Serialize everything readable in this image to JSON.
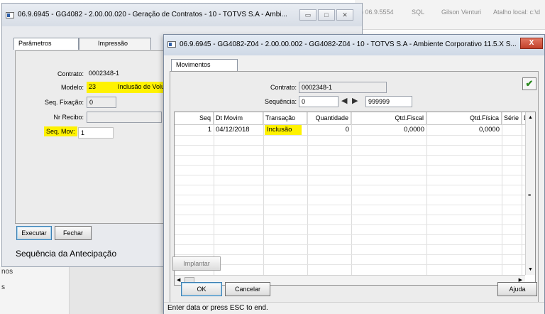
{
  "background": {
    "topbar": [
      "0) 06.9.5554",
      "SQL",
      "Gilson Venturi",
      "Atalho local: c:\\d"
    ],
    "side_items": [
      "nos",
      "s"
    ]
  },
  "win1": {
    "title": "06.9.6945 - GG4082 - 2.00.00.020 - Geração de Contratos - 10 - TOTVS S.A - Ambi...",
    "tabs": [
      "Parâmetros",
      "Impressão"
    ],
    "fields": {
      "contrato_label": "Contrato:",
      "contrato_value": "0002348-1",
      "modelo_label": "Modelo:",
      "modelo_value": "23",
      "modelo_desc": "Inclusão de Volu",
      "seq_fixacao_label": "Seq. Fixação:",
      "seq_fixacao_value": "0",
      "nr_recibo_label": "Nr Recibo:",
      "nr_recibo_value": "",
      "seq_mov_label": "Seq. Mov:",
      "seq_mov_value": "1"
    },
    "buttons": {
      "executar": "Executar",
      "fechar": "Fechar"
    },
    "status": "Sequência da Antecipação"
  },
  "win2": {
    "title": "06.9.6945 - GG4082-Z04 - 2.00.00.002 - GG4082-Z04 - 10 - TOTVS S.A - Ambiente Corporativo 11.5.X S...",
    "close_label": "X",
    "tab": "Movimentos",
    "contrato_label": "Contrato:",
    "contrato_value": "0002348-1",
    "sequencia_label": "Sequência:",
    "sequencia_from": "0",
    "sequencia_to": "999999",
    "grid": {
      "columns": [
        "Seq",
        "Dt Movim",
        "Transação",
        "Quantidade",
        "Qtd.Fiscal",
        "Qtd.Física",
        "Série",
        "Doc"
      ],
      "rows": [
        {
          "seq": "1",
          "dt": "04/12/2018",
          "transacao": "Inclusão",
          "quantidade": "0",
          "qtd_fiscal": "0,0000",
          "qtd_fisica": "0,0000",
          "serie": "",
          "doc": ""
        }
      ]
    },
    "buttons": {
      "implantar": "Implantar",
      "ok": "OK",
      "cancelar": "Cancelar",
      "ajuda": "Ajuda"
    },
    "footer": "Enter data or press ESC to end."
  },
  "colors": {
    "highlight": "#fff200",
    "confirm": "#2e8b22"
  }
}
